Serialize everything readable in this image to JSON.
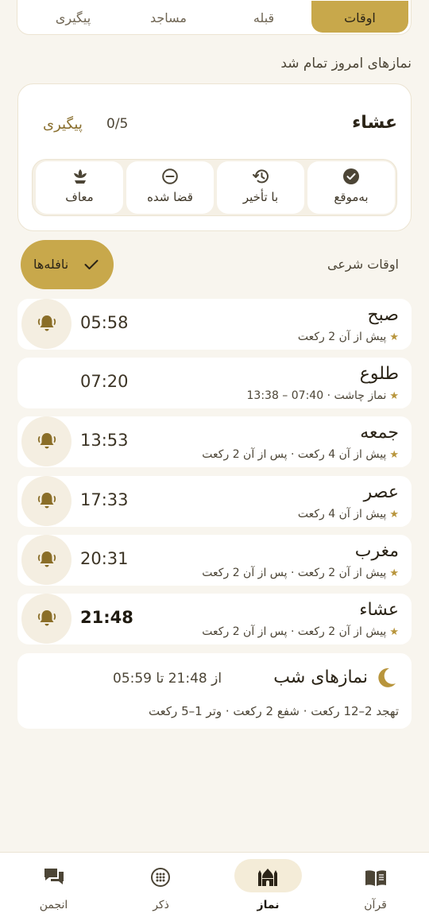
{
  "tabs": [
    {
      "label": "اوقات",
      "active": true
    },
    {
      "label": "قبله",
      "active": false
    },
    {
      "label": "مساجد",
      "active": false
    },
    {
      "label": "پیگیری",
      "active": false
    }
  ],
  "today_status": "نمازهای امروز تمام شد",
  "tracker": {
    "prayer": "عشاء",
    "count": "0/5",
    "label": "پیگیری",
    "statuses": [
      "به‌موقع",
      "با تأخیر",
      "قضا شده",
      "معاف"
    ]
  },
  "shari_label": "اوقات شرعی",
  "nafele_label": "نافله‌ها",
  "prayers": [
    {
      "name": "صبح",
      "time": "05:58",
      "sub": "پیش از آن 2 رکعت",
      "bell": true,
      "bold": false
    },
    {
      "name": "طلوع",
      "time": "07:20",
      "sub": "نماز چاشت · 07:40 – 13:38",
      "bell": false,
      "bold": false
    },
    {
      "name": "جمعه",
      "time": "13:53",
      "sub": "پیش از آن 4 رکعت · پس از آن 2 رکعت",
      "bell": true,
      "bold": false
    },
    {
      "name": "عصر",
      "time": "17:33",
      "sub": "پیش از آن 4 رکعت",
      "bell": true,
      "bold": false
    },
    {
      "name": "مغرب",
      "time": "20:31",
      "sub": "پیش از آن 2 رکعت · پس از آن 2 رکعت",
      "bell": true,
      "bold": false
    },
    {
      "name": "عشاء",
      "time": "21:48",
      "sub": "پیش از آن 2 رکعت · پس از آن 2 رکعت",
      "bell": true,
      "bold": true
    }
  ],
  "night": {
    "title": "نمازهای شب",
    "range": "از 21:48 تا 05:59",
    "detail": "تهجد 2–12 رکعت · شفع 2 رکعت · وتر 1–5 رکعت"
  },
  "nav": [
    {
      "label": "انجمن",
      "icon": "chat-icon",
      "active": false
    },
    {
      "label": "ذکر",
      "icon": "tasbih-icon",
      "active": false
    },
    {
      "label": "نماز",
      "icon": "mosque-icon",
      "active": true
    },
    {
      "label": "قرآن",
      "icon": "book-icon",
      "active": false
    }
  ],
  "colors": {
    "accent": "#c8a84b",
    "background": "#f8f5ee"
  }
}
